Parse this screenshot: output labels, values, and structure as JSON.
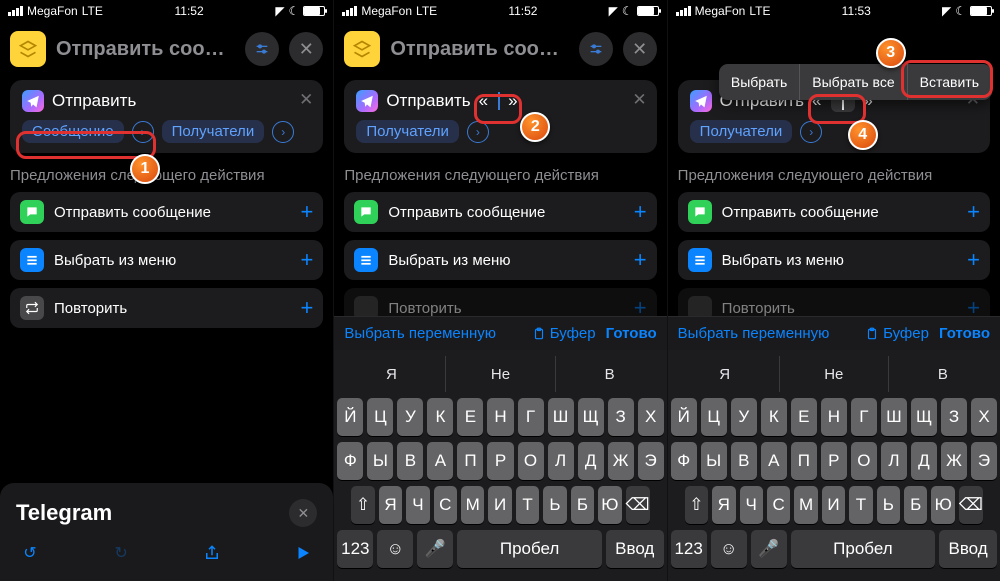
{
  "status": {
    "carrier": "MegaFon",
    "net": "LTE",
    "t1": "11:52",
    "t2": "11:52",
    "t3": "11:53"
  },
  "title": "Отправить соо…",
  "send_label": "Отправить",
  "quote_open": "«",
  "quote_close": "»",
  "tag_message": "Сообщение",
  "tag_recipients": "Получатели",
  "sect": "Предложения следующего действия",
  "sug1": "Отправить сообщение",
  "sug2": "Выбрать из меню",
  "sug3": "Повторить",
  "sug_part": "Повторить",
  "sheet_title": "Telegram",
  "kb_acc_var": "Выбрать переменную",
  "kb_acc_buf": "Буфер",
  "kb_acc_done": "Готово",
  "kb_s1": "Я",
  "kb_s2": "Не",
  "kb_s3": "В",
  "kb_r1": [
    "Й",
    "Ц",
    "У",
    "К",
    "Е",
    "Н",
    "Г",
    "Ш",
    "Щ",
    "З",
    "Х"
  ],
  "kb_r2": [
    "Ф",
    "Ы",
    "В",
    "А",
    "П",
    "Р",
    "О",
    "Л",
    "Д",
    "Ж",
    "Э"
  ],
  "kb_r3": [
    "Я",
    "Ч",
    "С",
    "М",
    "И",
    "Т",
    "Ь",
    "Б",
    "Ю"
  ],
  "kb_num": "123",
  "kb_space": "Пробел",
  "kb_enter": "Ввод",
  "ctx1": "Выбрать",
  "ctx2": "Выбрать все",
  "ctx3": "Вставить",
  "step1": "1",
  "step2": "2",
  "step3": "3",
  "step4": "4"
}
